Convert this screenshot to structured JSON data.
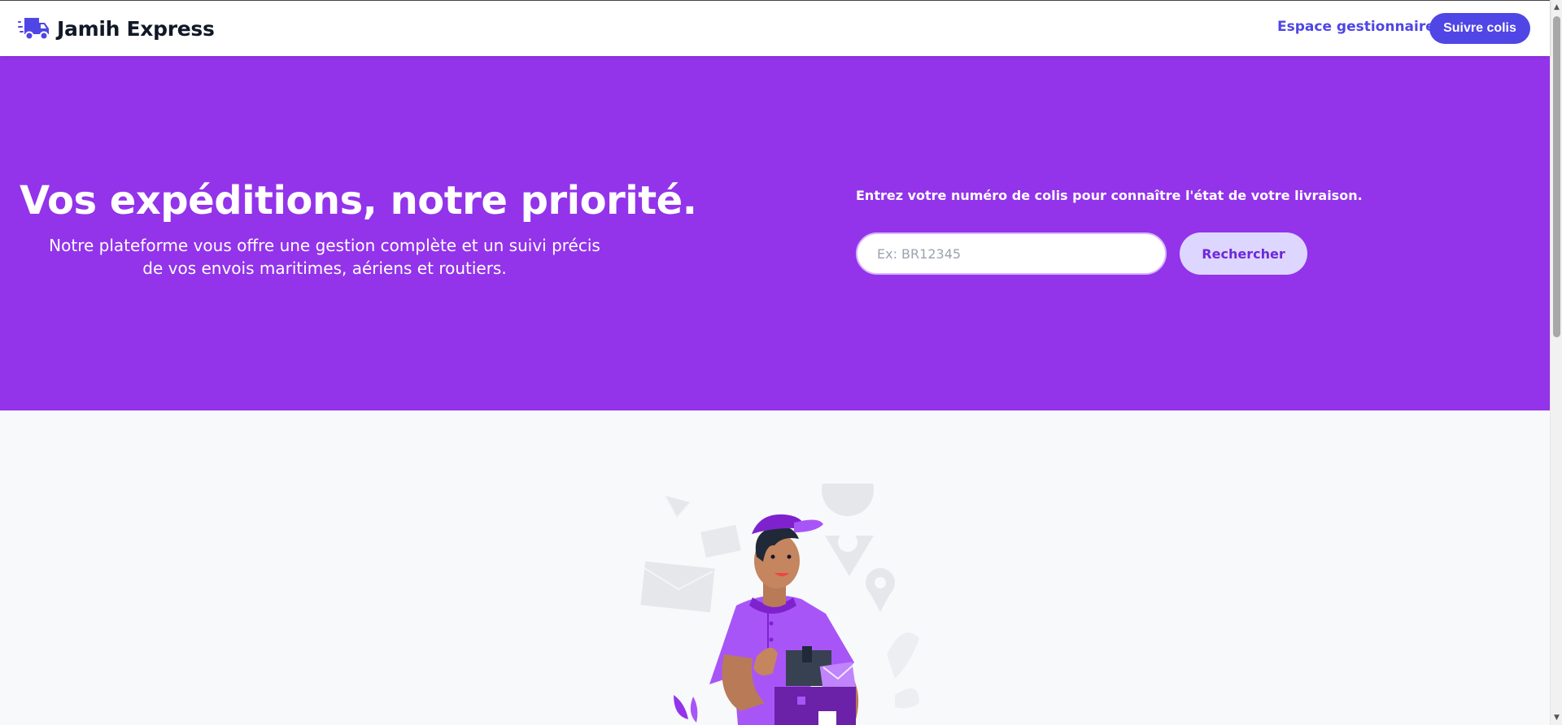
{
  "header": {
    "brand_name": "Jamih Express",
    "brand_icon": "truck-icon",
    "nav_link_label": "Espace gestionnaire",
    "nav_button_label": "Suivre colis"
  },
  "hero": {
    "title": "Vos expéditions, notre priorité.",
    "subtitle": "Notre plateforme vous offre une gestion complète et un suivi précis de vos envois maritimes, aériens et routiers.",
    "tracking_label": "Entrez votre numéro de colis pour connaître l'état de votre livraison.",
    "tracking_placeholder": "Ex: BR12345",
    "tracking_value": "",
    "search_button_label": "Rechercher"
  },
  "colors": {
    "brand": "#4f46e5",
    "hero_background": "#9333ea",
    "search_button_bg": "#ddd6fe",
    "search_button_text": "#6d28d9"
  },
  "illustration": {
    "icon": "delivery-man-icon"
  }
}
